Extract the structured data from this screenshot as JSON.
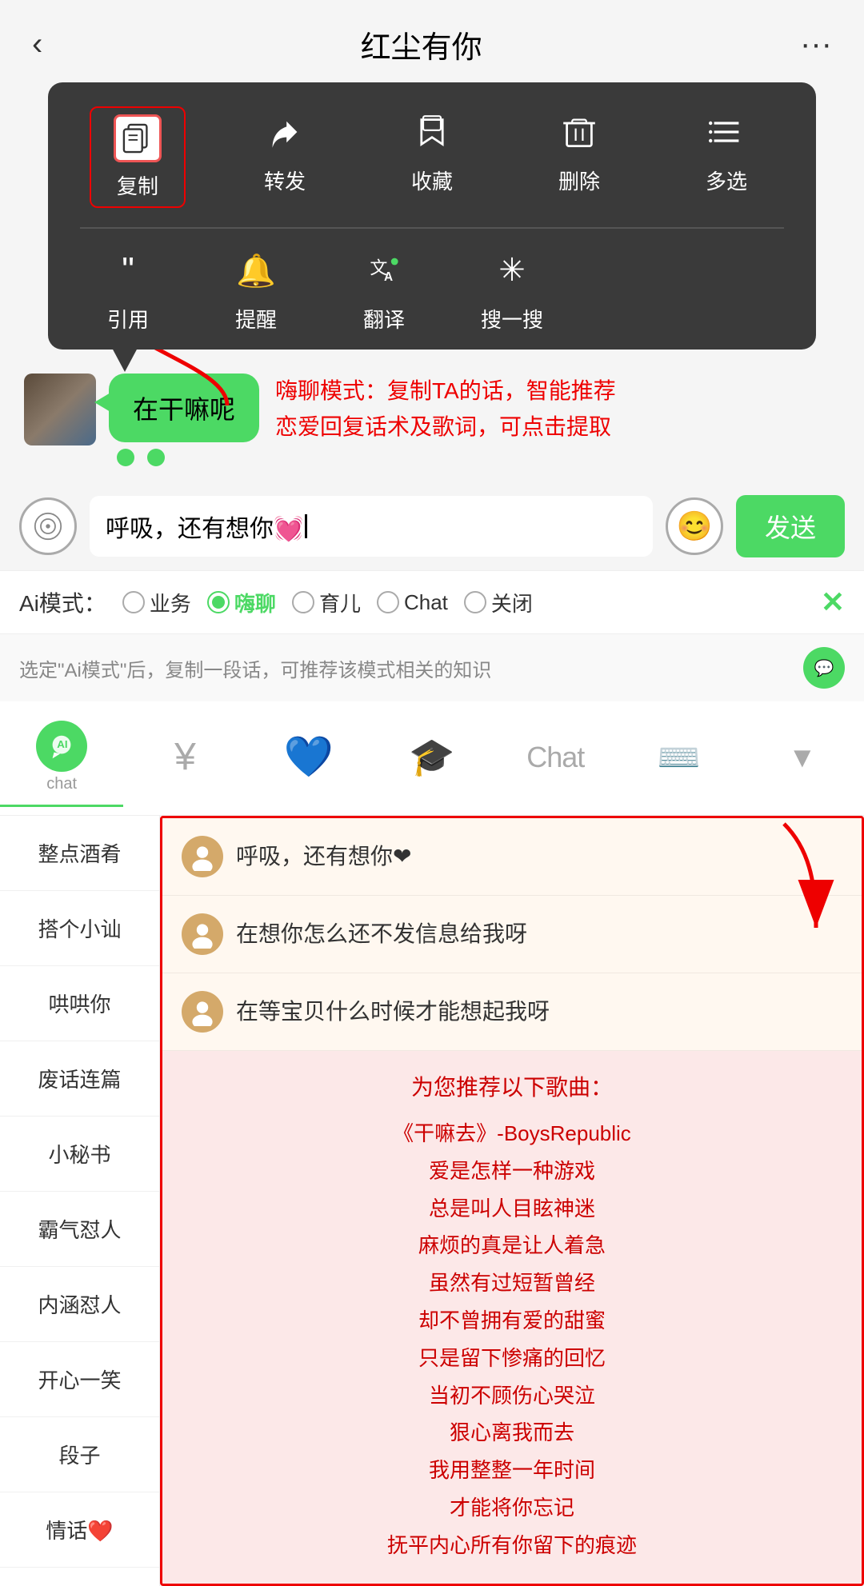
{
  "header": {
    "title": "红尘有你",
    "back_icon": "‹",
    "more_icon": "···"
  },
  "context_menu": {
    "items_row1": [
      {
        "id": "copy",
        "icon": "copy",
        "label": "复制",
        "highlighted": true
      },
      {
        "id": "forward",
        "icon": "forward",
        "label": "转发"
      },
      {
        "id": "collect",
        "icon": "cube",
        "label": "收藏"
      },
      {
        "id": "delete",
        "icon": "trash",
        "label": "删除"
      },
      {
        "id": "multiselect",
        "icon": "list",
        "label": "多选"
      }
    ],
    "items_row2": [
      {
        "id": "quote",
        "icon": "quote",
        "label": "引用"
      },
      {
        "id": "remind",
        "icon": "bell",
        "label": "提醒"
      },
      {
        "id": "translate",
        "icon": "translate",
        "label": "翻译"
      },
      {
        "id": "search",
        "icon": "search",
        "label": "搜一搜"
      }
    ]
  },
  "annotation": {
    "text": "嗨聊模式：复制TA的话，智能推荐\n恋爱回复话术及歌词，可点击提取"
  },
  "chat_bubble": {
    "text": "在干嘛呢"
  },
  "input": {
    "value": "呼吸，还有想你💓",
    "send_label": "发送"
  },
  "ai_modes": {
    "label": "Ai模式：",
    "options": [
      {
        "id": "business",
        "label": "业务",
        "selected": false
      },
      {
        "id": "haichat",
        "label": "嗨聊",
        "selected": true
      },
      {
        "id": "parenting",
        "label": "育儿",
        "selected": false
      },
      {
        "id": "chat",
        "label": "Chat",
        "selected": false
      },
      {
        "id": "off",
        "label": "关闭",
        "selected": false
      }
    ],
    "close_label": "✕"
  },
  "ai_hint": {
    "text": "选定\"Ai模式\"后，复制一段话，可推荐该模式相关的知识"
  },
  "toolbar": {
    "items": [
      {
        "id": "chat-ai",
        "icon": "🤖",
        "label": "chat",
        "active": true
      },
      {
        "id": "money",
        "icon": "¥",
        "label": "",
        "active": false
      },
      {
        "id": "heart",
        "icon": "💙",
        "label": "",
        "active": false
      },
      {
        "id": "study",
        "icon": "🎓",
        "label": "",
        "active": false
      },
      {
        "id": "chat-btn",
        "icon": "Chat",
        "label": "",
        "active": false
      },
      {
        "id": "keyboard",
        "icon": "⌨",
        "label": "",
        "active": false
      },
      {
        "id": "expand",
        "icon": "▼",
        "label": "",
        "active": false
      }
    ]
  },
  "sidebar": {
    "items": [
      {
        "id": "zhengdian",
        "label": "整点酒肴"
      },
      {
        "id": "dage",
        "label": "搭个小讪"
      },
      {
        "id": "haohaoni",
        "label": "哄哄你"
      },
      {
        "id": "feihua",
        "label": "废话连篇"
      },
      {
        "id": "xiaomishu",
        "label": "小秘书"
      },
      {
        "id": "baqiren",
        "label": "霸气怼人"
      },
      {
        "id": "neihanren",
        "label": "内涵怼人"
      },
      {
        "id": "kaixin",
        "label": "开心一笑"
      },
      {
        "id": "duanzi",
        "label": "段子"
      },
      {
        "id": "qinghua",
        "label": "情话❤️"
      }
    ]
  },
  "suggestions": [
    {
      "id": "s1",
      "text": "呼吸，还有想你❤"
    },
    {
      "id": "s2",
      "text": "在想你怎么还不发信息给我呀"
    },
    {
      "id": "s3",
      "text": "在等宝贝什么时候才能想起我呀"
    }
  ],
  "song_section": {
    "title": "为您推荐以下歌曲：",
    "song_name": "《干嘛去》-BoysRepublic",
    "lyrics": [
      "爱是怎样一种游戏",
      "总是叫人目眩神迷",
      "麻烦的真是让人着急",
      "虽然有过短暂曾经",
      "却不曾拥有爱的甜蜜",
      "只是留下惨痛的回忆",
      "当初不顾伤心哭泣",
      "狠心离我而去",
      "我用整整一年时间",
      "才能将你忘记",
      "抚平内心所有你留下的痕迹"
    ]
  }
}
